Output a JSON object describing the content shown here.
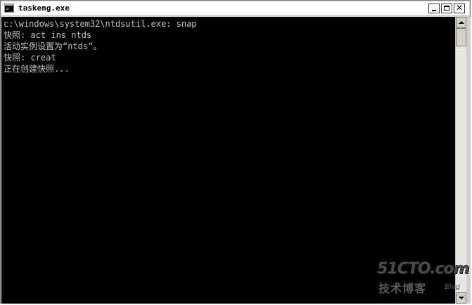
{
  "window": {
    "title": "taskeng.exe",
    "close_glyph": "✕"
  },
  "console": {
    "lines": [
      "c:\\windows\\system32\\ntdsutil.exe: snap",
      "快照: act ins ntds",
      "活动实例设置为“ntds”。",
      "快照: creat",
      "正在创建快照..."
    ]
  },
  "icon": {
    "prompt": ">_"
  },
  "watermark": {
    "main": "51CTO.com",
    "sub": "技术博客",
    "blog": "Blog"
  },
  "colors": {
    "console_bg": "#000000",
    "console_text": "#c0c0c0",
    "titlebar_bg": "#ffffff"
  },
  "icons": [
    "console-app-icon",
    "minimize-icon",
    "maximize-icon",
    "close-icon",
    "scroll-up-arrow-icon",
    "scroll-down-arrow-icon"
  ]
}
